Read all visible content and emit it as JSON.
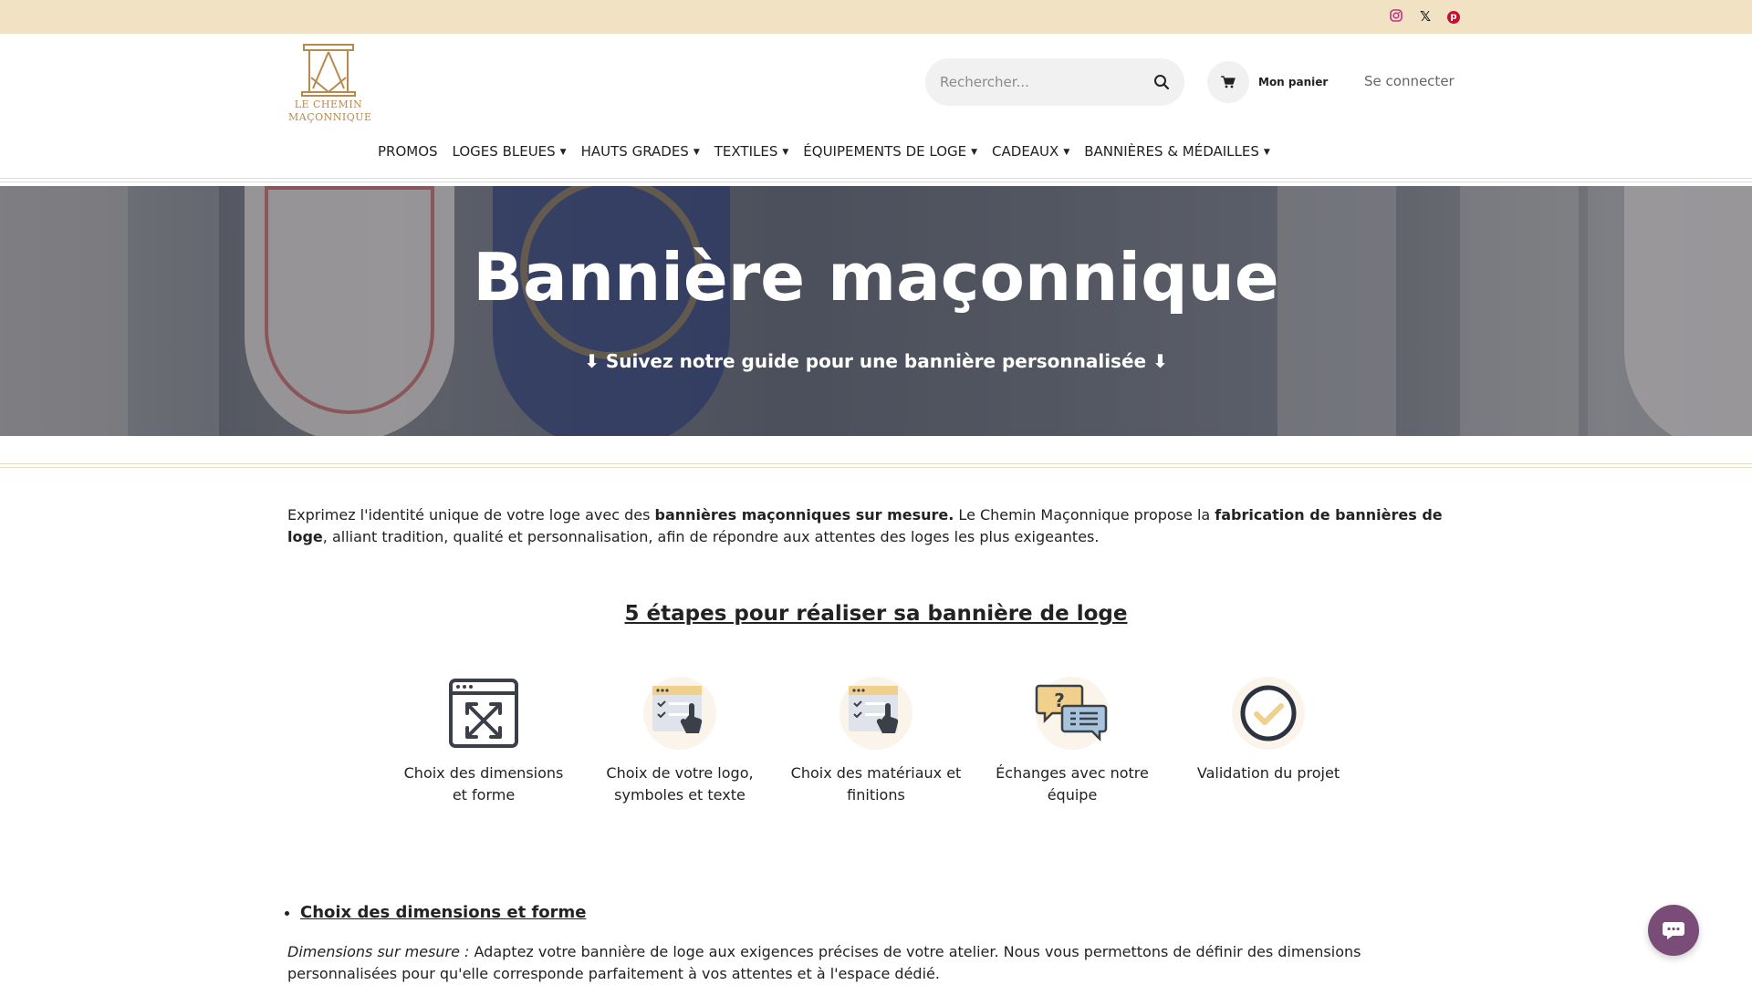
{
  "social": {
    "instagram_icon": "instagram-icon",
    "x_label": "𝕏",
    "pinterest_label": "p"
  },
  "logo": {
    "line1": "LE CHEMIN",
    "line2": "MAÇONNIQUE"
  },
  "header": {
    "search_placeholder": "Rechercher...",
    "cart_label": "Mon panier",
    "login_label": "Se connecter"
  },
  "nav": {
    "items": [
      {
        "label": "PROMOS",
        "dropdown": false
      },
      {
        "label": "LOGES BLEUES",
        "dropdown": true
      },
      {
        "label": "HAUTS GRADES",
        "dropdown": true
      },
      {
        "label": "TEXTILES",
        "dropdown": true
      },
      {
        "label": "ÉQUIPEMENTS DE LOGE",
        "dropdown": true
      },
      {
        "label": "CADEAUX",
        "dropdown": true
      },
      {
        "label": "BANNIÈRES & MÉDAILLES",
        "dropdown": true
      }
    ]
  },
  "hero": {
    "title": "Bannière maçonnique",
    "subtitle": "⬇ Suivez notre guide pour une bannière personnalisée ⬇"
  },
  "intro": {
    "part1": "Exprimez l'identité unique de votre loge avec des ",
    "bold1": "bannières maçonniques sur mesure.",
    "part2": " Le Chemin Maçonnique propose la ",
    "bold2": "fabrication de bannières de loge",
    "part3": ", alliant tradition, qualité et personnalisation, afin de répondre aux attentes des loges les plus exigeantes."
  },
  "steps": {
    "title": "5 étapes pour réaliser sa bannière de loge",
    "items": [
      {
        "label": "Choix des dimensions et forme",
        "icon": "resize-window-icon"
      },
      {
        "label": "Choix de votre logo, symboles et texte",
        "icon": "checklist-touch-icon"
      },
      {
        "label": "Choix des matériaux et finitions",
        "icon": "checklist-touch-icon"
      },
      {
        "label": "Échanges avec notre équipe",
        "icon": "chat-bubbles-icon"
      },
      {
        "label": "Validation du projet",
        "icon": "check-circle-icon"
      }
    ]
  },
  "section1": {
    "heading": "Choix des dimensions et forme",
    "lead": "Dimensions sur mesure :",
    "text": " Adaptez votre bannière de loge aux exigences précises de votre atelier. Nous vous permettons de définir des dimensions personnalisées pour qu'elle corresponde parfaitement à vos attentes et à l'espace dédié."
  },
  "colors": {
    "topbar": "#f2e2c4",
    "gold": "#b8894d",
    "chat": "#7a4d79"
  }
}
